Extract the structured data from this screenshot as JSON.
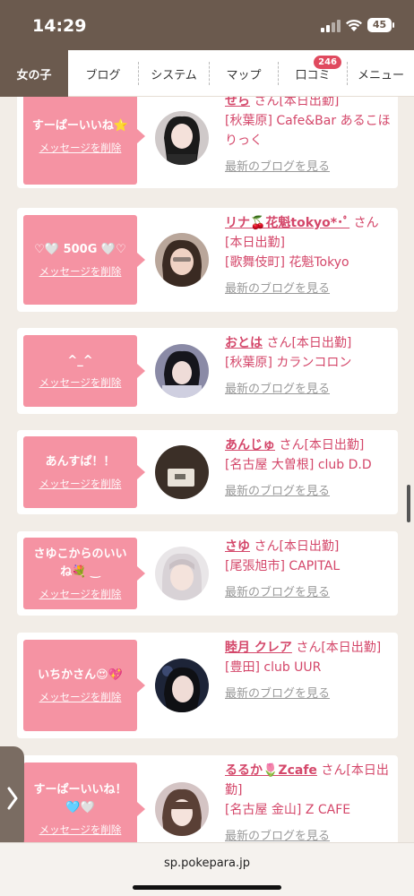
{
  "status": {
    "time": "14:29",
    "battery": "45"
  },
  "nav": {
    "tabs": [
      {
        "label": "女の子",
        "active": true
      },
      {
        "label": "ブログ"
      },
      {
        "label": "システム"
      },
      {
        "label": "マップ"
      },
      {
        "label": "口コミ",
        "badge": "246"
      },
      {
        "label": "メニュー"
      }
    ]
  },
  "labels": {
    "delete": "メッセージを削除",
    "blog": "最新のブログを見る",
    "san": "さん"
  },
  "cards": [
    {
      "message": "すーぱーいいね⭐",
      "name": "せら",
      "status": "[本日出勤]",
      "shop": "[秋葉原] Cafe&Bar あるこほりっく"
    },
    {
      "message": "♡🤍 500G 🤍♡",
      "name": "リナ🍒花魁tokyo*･ﾟ",
      "status": "[本日出勤]",
      "shop": "[歌舞伎町] 花魁Tokyo"
    },
    {
      "message": "^_^",
      "name": "おとは",
      "status": "[本日出勤]",
      "shop": "[秋葉原] カランコロン"
    },
    {
      "message": "あんすぱ！！",
      "name": "あんじゅ",
      "status": "[本日出勤]",
      "shop": "[名古屋 大曽根] club D.D"
    },
    {
      "message": "さゆこからのいいね💐 ‿",
      "name": "さゆ",
      "status": "[本日出勤]",
      "shop": "[尾張旭市] CAPITAL"
    },
    {
      "message": "いちかさん😍💖",
      "name": "睦月 クレア",
      "status": "[本日出勤]",
      "shop": "[豊田] club UUR"
    },
    {
      "message": "すーぱーいいね！🩵🤍",
      "name": "るるか🌷Zcafe",
      "status": "[本日出勤]",
      "shop": "[名古屋 金山] Z CAFE"
    }
  ],
  "colors": {
    "brand": "#6b5a4e",
    "bubble": "#f593a3",
    "accent": "#d4476a"
  },
  "url": "sp.pokepara.jp"
}
